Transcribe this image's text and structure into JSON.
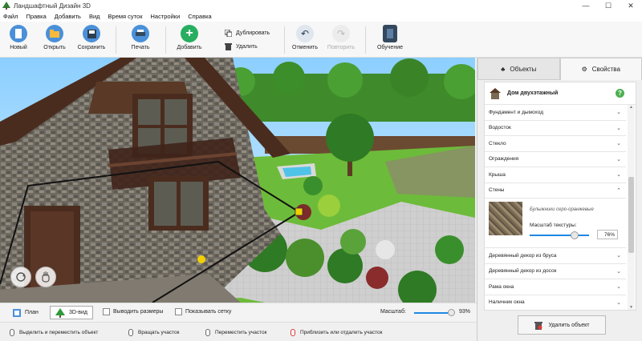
{
  "window": {
    "title": "Ландшафтный Дизайн 3D",
    "minimize": "—",
    "maximize": "☐",
    "close": "✕"
  },
  "menu": [
    "Файл",
    "Правка",
    "Добавить",
    "Вид",
    "Время суток",
    "Настройки",
    "Справка"
  ],
  "toolbar": {
    "new": "Новый",
    "open": "Открыть",
    "save": "Сохранить",
    "print": "Печать",
    "add": "Добавить",
    "duplicate": "Дублировать",
    "delete": "Удалить",
    "undo": "Отменить",
    "redo": "Повторить",
    "learn": "Обучение"
  },
  "tabs": {
    "objects": "Объекты",
    "properties": "Свойства"
  },
  "object": {
    "name": "Дом двухэтажный",
    "help": "?"
  },
  "sections_top": [
    "Фундамент и дымоход",
    "Водосток",
    "Стекло",
    "Ограждения",
    "Крыша",
    "Стены"
  ],
  "walls": {
    "texture_name": "Булыжники серо-оранжевые",
    "scale_label": "Масштаб текстуры:",
    "scale_value": "76%",
    "scale_fraction": 0.76
  },
  "sections_bottom": [
    "Деревянный декор из бруса",
    "Деревянный декор из досок",
    "Рама окна",
    "Наличник окна"
  ],
  "delete_object": "Удалить объект",
  "view": {
    "plan": "План",
    "view3d": "3D-вид",
    "show_dimensions": "Выводить размеры",
    "show_grid": "Показывать сетку",
    "scale_label": "Масштаб:",
    "scale_value": "93%",
    "scale_fraction": 0.93
  },
  "status": {
    "select_move": "Выделить и переместить объект",
    "rotate": "Вращать участок",
    "pan": "Переместить участок",
    "zoom": "Приблизить или отдалить участок"
  },
  "colors": {
    "accent": "#1e88e5",
    "add_green": "#27ae60",
    "sky": "#8fd3ff",
    "grass": "#6dbb3a",
    "wood": "#4a2c1e"
  }
}
